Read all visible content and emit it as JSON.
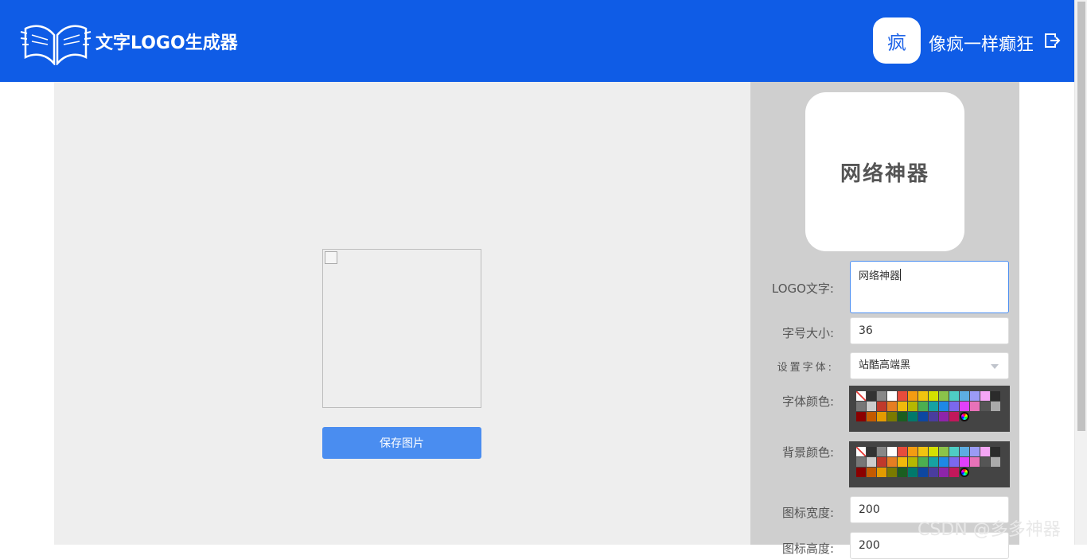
{
  "header": {
    "brand_title": "文字LOGO生成器",
    "avatar_text": "疯",
    "username": "像疯一样癫狂",
    "colors": {
      "bar": "#0f5ce6"
    }
  },
  "preview": {
    "save_label": "保存图片"
  },
  "panel": {
    "logo_preview_text": "网络神器",
    "logo_text_label": "LOGO文字:",
    "logo_text_value": "网络神器",
    "font_size_label": "字号大小:",
    "font_size_value": "36",
    "font_label": "设置字体:",
    "font_value": "站酷高端黑",
    "font_color_label": "字体颜色:",
    "bg_color_label": "背景颜色:",
    "width_label": "图标宽度:",
    "width_value": "200",
    "height_label": "图标高度:",
    "height_value": "200"
  },
  "palette_colors": [
    "none",
    "#333333",
    "#888888",
    "#ffffff",
    "#e74c3c",
    "#f39c12",
    "#f1c40f",
    "#d4e000",
    "#8bc34a",
    "#4ecdc4",
    "#5dade2",
    "#9b9bf5",
    "#f5a6f5",
    "#2b2b2b",
    "#777777",
    "#cccccc",
    "#c0392b",
    "#e67e22",
    "#f0b90b",
    "#b5b800",
    "#4caf50",
    "#16a2a2",
    "#1e88e5",
    "#7b68ee",
    "#e040fb",
    "#e872b8",
    "#555555",
    "#aaaaaa",
    "#8b0000",
    "#c45a00",
    "#e39b00",
    "#7a7a00",
    "#1b5e20",
    "#00796b",
    "#0d47a1",
    "#4a3d9e",
    "#8e24aa",
    "#c2185b",
    "wheel"
  ],
  "watermark": "CSDN @多多神器"
}
